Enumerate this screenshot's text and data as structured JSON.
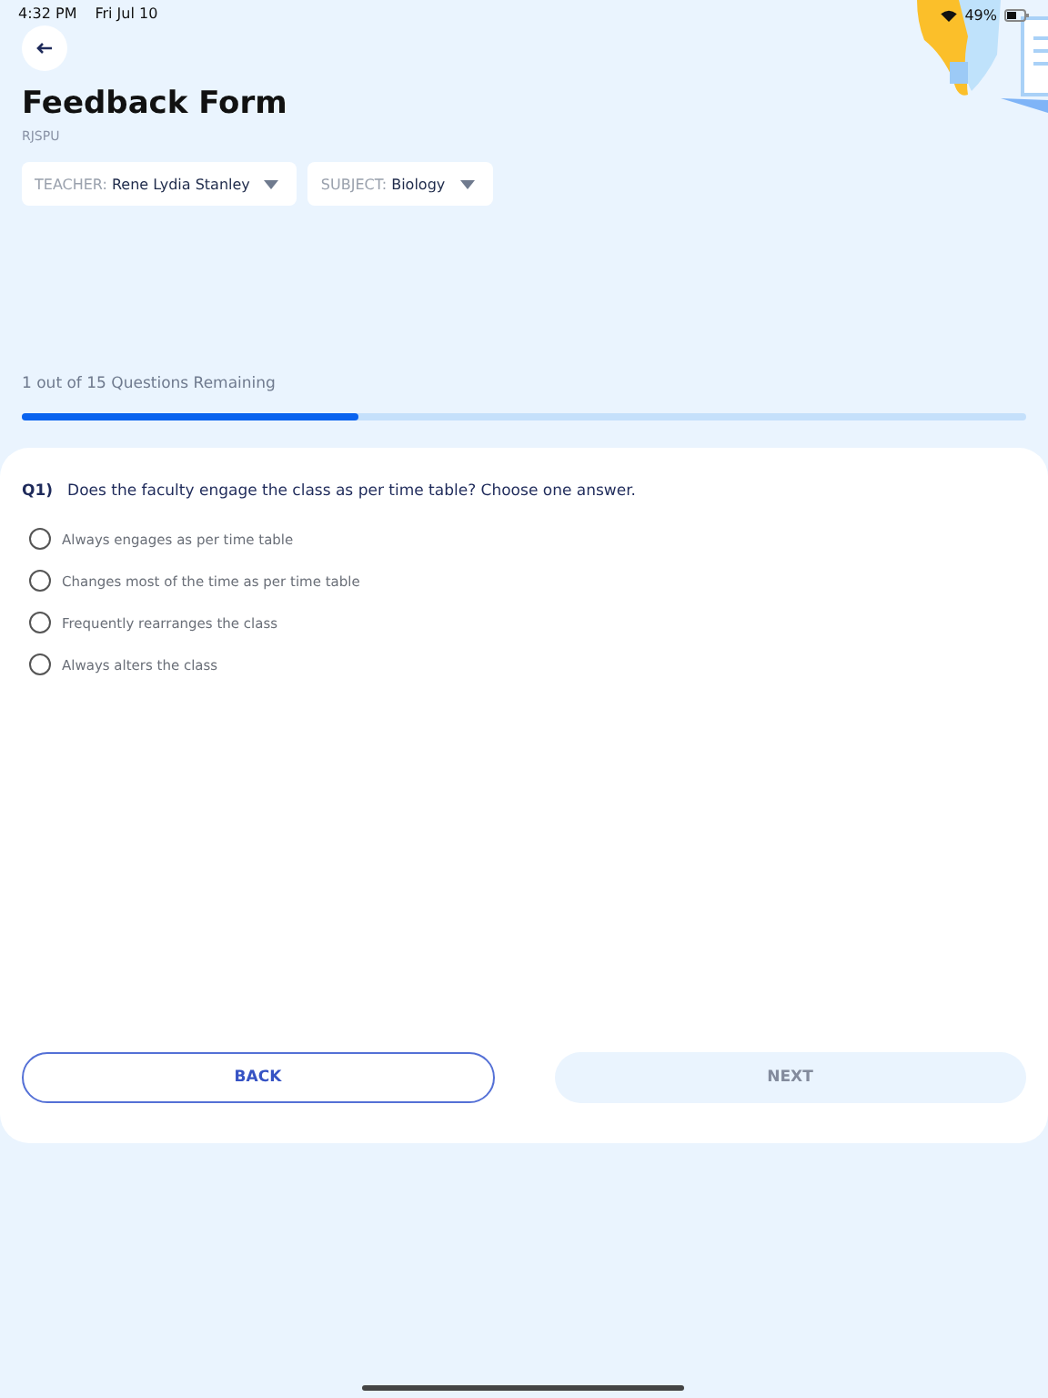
{
  "status_bar": {
    "time": "4:32 PM",
    "date": "Fri Jul 10",
    "battery": "49%"
  },
  "header": {
    "title": "Feedback Form",
    "subtitle": "RJSPU"
  },
  "filters": [
    {
      "label": "TEACHER:",
      "value": "Rene Lydia Stanley"
    },
    {
      "label": "SUBJECT:",
      "value": "Biology"
    }
  ],
  "progress": {
    "text": "1 out of 15 Questions Remaining",
    "level": 0.335
  },
  "question": {
    "number": "Q1)",
    "text": "Does the faculty engage the class as per time table? Choose one answer.",
    "options": [
      {
        "label": "Always engages as per time table",
        "selected": false
      },
      {
        "label": "Changes most of the time as per time table",
        "selected": false
      },
      {
        "label": "Frequently rearranges the class",
        "selected": false
      },
      {
        "label": "Always alters the class",
        "selected": false
      }
    ]
  },
  "buttons": [
    {
      "label": "BACK",
      "disabled": false
    },
    {
      "label": "NEXT",
      "disabled": true
    }
  ]
}
